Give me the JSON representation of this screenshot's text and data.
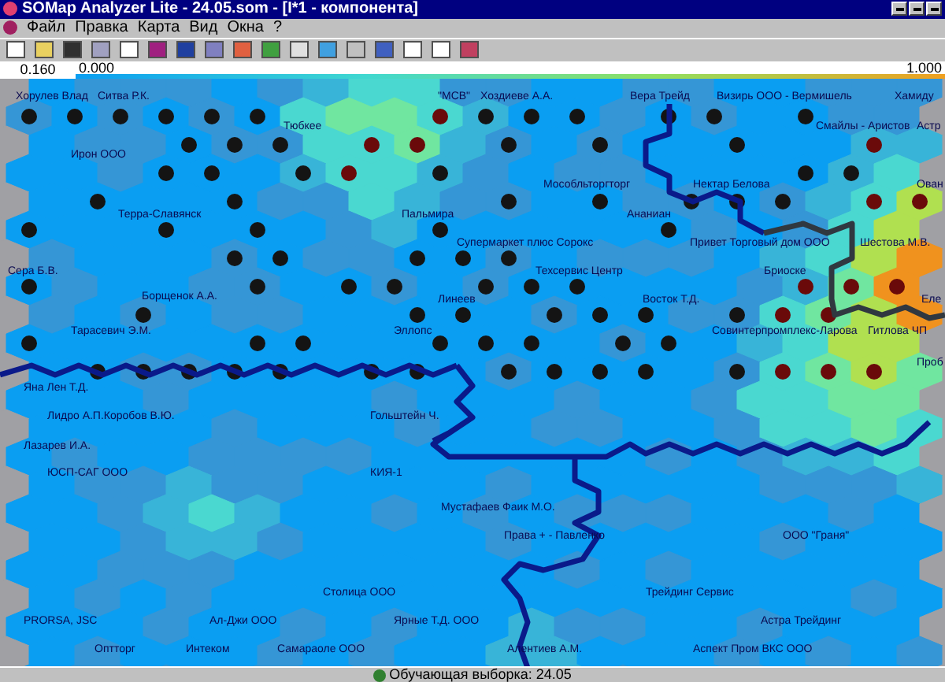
{
  "window": {
    "title": "SOMap Analyzer Lite - 24.05.som - [I*1 - компонента]"
  },
  "menu": [
    "Файл",
    "Правка",
    "Карта",
    "Вид",
    "Окна",
    "?"
  ],
  "scale": {
    "value": "0.160",
    "min": "0.000",
    "max": "1.000"
  },
  "map_labels": [
    "Хорулев Влад",
    "Ситва Р.К.",
    "\"МСВ\"",
    "Хоздиеве А.А.",
    "Вера Трейд",
    "Визирь ООО - Вермишель",
    "Хамиду",
    "Тюбкее",
    "Смайлы - Аристов",
    "Астр",
    "Ирон ООО",
    "Мособльторгторг",
    "Нектар Белова",
    "Ован",
    "Терра-Славянск",
    "Пальмира",
    "Ананиан",
    "Супермаркет плюс Сорокс",
    "Привет Торговый дом ООО",
    "Шестова М.В.",
    "Сера Б.В.",
    "Техсервис Центр",
    "Бриоске",
    "Борщенок А.А.",
    "Линеев",
    "Восток Т.Д.",
    "Еле",
    "Тарасевич Э.М.",
    "Эллопс",
    "Совинтерпромплекс-Ларова",
    "Гитлова ЧП",
    "Проб",
    "Яна Лен Т.Д.",
    "Лидро А.П.Коробов В.Ю.",
    "Гольштейн Ч.",
    "Лазарев И.А.",
    "ЮСП-САГ ООО",
    "КИЯ-1",
    "Мустафаев Фаик М.О.",
    "Права + - Павленко",
    "ООО \"Граня\"",
    "Столица ООО",
    "Трейдинг Сервис",
    "PRORSA, JSC",
    "Ал-Джи ООО",
    "Ярные Т.Д. ООО",
    "Астра Трейдинг",
    "Оптторг",
    "Интеком",
    "Самараоле ООО",
    "Алентиев А.М.",
    "Аспект Пром ВКС ООО"
  ],
  "status_bar": {
    "text": "Обучающая выборка: 24.05"
  }
}
